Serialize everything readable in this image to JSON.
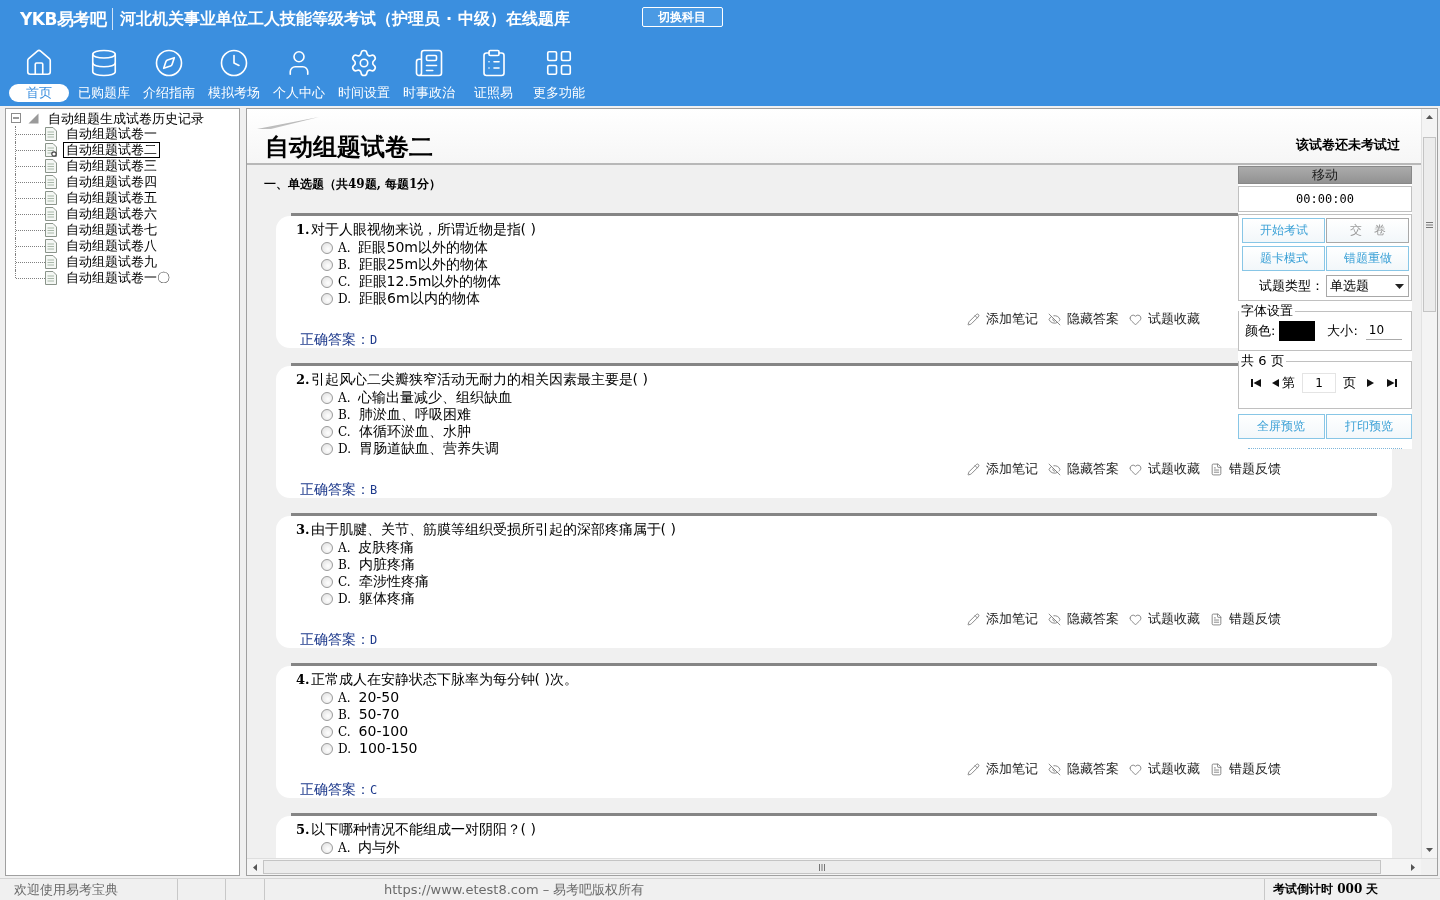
{
  "header": {
    "logo": "YKB易考吧",
    "title": "河北机关事业单位工人技能等级考试（护理员 · 中级）在线题库",
    "switch_button": "切换科目"
  },
  "nav": [
    {
      "label": "首页",
      "selected": true
    },
    {
      "label": "已购题库",
      "selected": false
    },
    {
      "label": "介绍指南",
      "selected": false
    },
    {
      "label": "模拟考场",
      "selected": false
    },
    {
      "label": "个人中心",
      "selected": false
    },
    {
      "label": "时间设置",
      "selected": false
    },
    {
      "label": "时事政治",
      "selected": false
    },
    {
      "label": "证照易",
      "selected": false
    },
    {
      "label": "更多功能",
      "selected": false
    }
  ],
  "sidebar": {
    "tree": {
      "label": "自动组题生成试卷历史记录",
      "expanded": true,
      "children": [
        {
          "label": "自动组题试卷一",
          "selected": false
        },
        {
          "label": "自动组题试卷二",
          "selected": true
        },
        {
          "label": "自动组题试卷三",
          "selected": false
        },
        {
          "label": "自动组题试卷四",
          "selected": false
        },
        {
          "label": "自动组题试卷五",
          "selected": false
        },
        {
          "label": "自动组题试卷六",
          "selected": false
        },
        {
          "label": "自动组题试卷七",
          "selected": false
        },
        {
          "label": "自动组题试卷八",
          "selected": false
        },
        {
          "label": "自动组题试卷九",
          "selected": false
        },
        {
          "label": "自动组题试卷一〇",
          "selected": false
        }
      ]
    }
  },
  "content": {
    "title": "自动组题试卷二",
    "status": "该试卷还未考试过",
    "section": "一、单选题（共49题, 每题1分）",
    "questions": [
      {
        "number": "1.",
        "text": "对于人眼视物来说，所谓近物是指( )",
        "options": [
          {
            "letter": "A.",
            "text": "距眼50m以外的物体",
            "selected": false
          },
          {
            "letter": "B.",
            "text": "距眼25m以外的物体",
            "selected": false
          },
          {
            "letter": "C.",
            "text": "距眼12.5m以外的物体",
            "selected": false
          },
          {
            "letter": "D.",
            "text": "距眼6m以内的物体",
            "selected": false
          }
        ],
        "actions": [
          "添加笔记",
          "隐藏答案",
          "试题收藏"
        ],
        "answer_label": "正确答案：",
        "answer": "D"
      },
      {
        "number": "2.",
        "text": "引起风心二尖瓣狭窄活动无耐力的相关因素最主要是( )",
        "options": [
          {
            "letter": "A.",
            "text": "心输出量减少、组织缺血",
            "selected": false
          },
          {
            "letter": "B.",
            "text": "肺淤血、呼吸困难",
            "selected": false
          },
          {
            "letter": "C.",
            "text": "体循环淤血、水肿",
            "selected": false
          },
          {
            "letter": "D.",
            "text": "胃肠道缺血、营养失调",
            "selected": false
          }
        ],
        "actions": [
          "添加笔记",
          "隐藏答案",
          "试题收藏",
          "错题反馈"
        ],
        "answer_label": "正确答案：",
        "answer": "B"
      },
      {
        "number": "3.",
        "text": "由于肌腱、关节、筋膜等组织受损所引起的深部疼痛属于( )",
        "options": [
          {
            "letter": "A.",
            "text": "皮肤疼痛",
            "selected": false
          },
          {
            "letter": "B.",
            "text": "内脏疼痛",
            "selected": false
          },
          {
            "letter": "C.",
            "text": "牵涉性疼痛",
            "selected": false
          },
          {
            "letter": "D.",
            "text": "躯体疼痛",
            "selected": false
          }
        ],
        "actions": [
          "添加笔记",
          "隐藏答案",
          "试题收藏",
          "错题反馈"
        ],
        "answer_label": "正确答案：",
        "answer": "D"
      },
      {
        "number": "4.",
        "text": "正常成人在安静状态下脉率为每分钟( )次。",
        "options": [
          {
            "letter": "A.",
            "text": "20-50",
            "selected": false
          },
          {
            "letter": "B.",
            "text": "50-70",
            "selected": false
          },
          {
            "letter": "C.",
            "text": "60-100",
            "selected": false
          },
          {
            "letter": "D.",
            "text": "100-150",
            "selected": false
          }
        ],
        "actions": [
          "添加笔记",
          "隐藏答案",
          "试题收藏",
          "错题反馈"
        ],
        "answer_label": "正确答案：",
        "answer": "C"
      },
      {
        "number": "5.",
        "text": "以下哪种情况不能组成一对阴阳？( )",
        "options": [
          {
            "letter": "A.",
            "text": "内与外",
            "selected": false
          }
        ]
      }
    ]
  },
  "panel": {
    "title": "移动",
    "timer": "00:00:00",
    "buttons": [
      {
        "label": "开始考试",
        "disabled": false
      },
      {
        "label": "交　卷",
        "disabled": true
      },
      {
        "label": "题卡模式",
        "disabled": false
      },
      {
        "label": "错题重做",
        "disabled": false
      }
    ],
    "type_label": "试题类型：",
    "type_value": "单选题",
    "font_group": {
      "legend": "字体设置",
      "color_label": "颜色:",
      "color": "#000000",
      "size_label": "大小:",
      "size": "10"
    },
    "pager": {
      "legend": "共 6 页",
      "prefix": "第",
      "page": "1",
      "suffix": "页"
    },
    "preview_buttons": [
      "全屏预览",
      "打印预览"
    ]
  },
  "status_bar": {
    "welcome": "欢迎使用易考宝典",
    "copyright": "https://www.etest8.com – 易考吧版权所有",
    "countdown": "考试倒计时 000 天"
  }
}
